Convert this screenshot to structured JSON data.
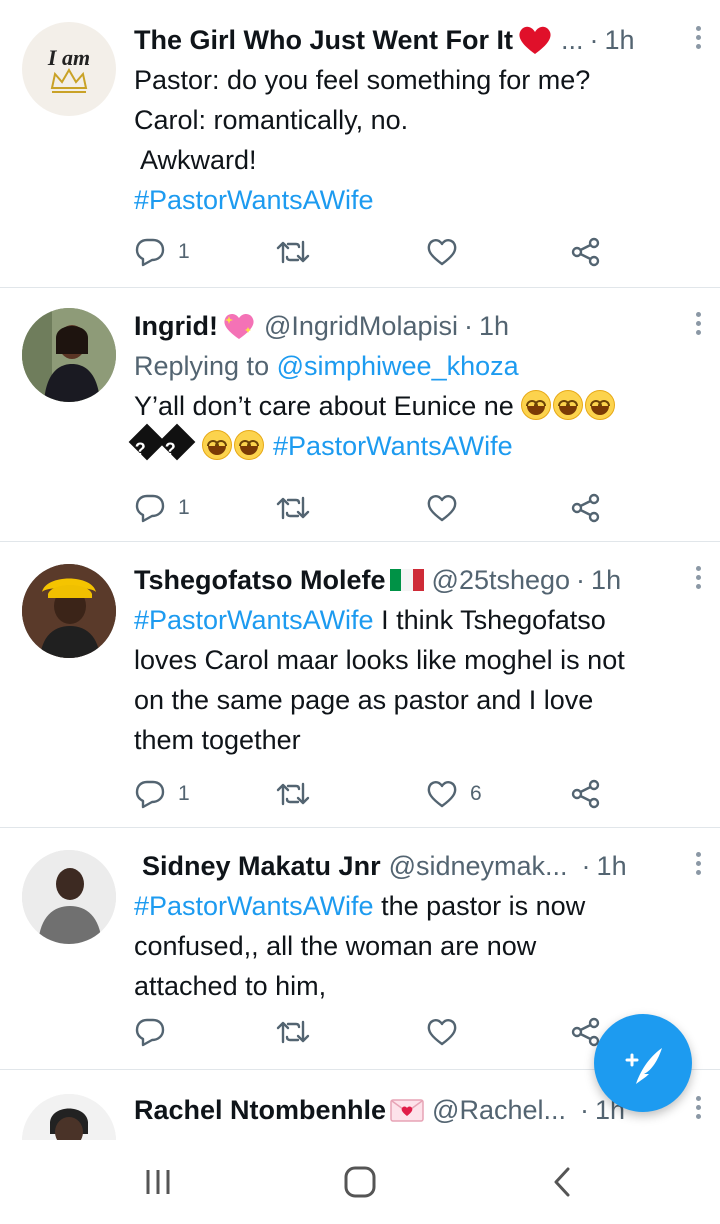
{
  "tweets": [
    {
      "name": "The Girl Who Just Went For It",
      "name_badge": "red-heart",
      "handle": "...",
      "time": "1h",
      "lines": [
        "Pastor: do you feel something for me?",
        "Carol: romantically, no.",
        " Awkward!"
      ],
      "hashtag": "#PastorWantsAWife",
      "reply_count": "1",
      "retweet_count": "",
      "like_count": ""
    },
    {
      "name": "Ingrid!",
      "name_badge": "sparkling-heart",
      "handle": "@IngridMolapisi",
      "time": "1h",
      "replying_label": "Replying to",
      "replying_to": "@simphiwee_khoza",
      "text": "Y’all don’t care about Eunice ne",
      "hashtag": "#PastorWantsAWife",
      "reply_count": "1",
      "retweet_count": "",
      "like_count": ""
    },
    {
      "name": "Tshegofatso Molefe",
      "name_badge": "italy-flag",
      "handle": "@25tshego",
      "time": "1h",
      "hashtag": "#PastorWantsAWife",
      "text_after_hashtag": " I think Tshegofatso",
      "lines": [
        "loves Carol maar looks like moghel is not",
        "on the same page as pastor and I love",
        "them together"
      ],
      "reply_count": "1",
      "retweet_count": "",
      "like_count": "6"
    },
    {
      "name": "Sidney Makatu Jnr",
      "handle": "@sidneymak...",
      "time": "1h",
      "hashtag": "#PastorWantsAWife",
      "text_after_hashtag": " the pastor is now",
      "lines": [
        "confused,, all the woman are now",
        "attached to him,"
      ],
      "reply_count": "",
      "retweet_count": "",
      "like_count": ""
    },
    {
      "name": "Rachel Ntombenhle",
      "name_badge": "love-letter",
      "handle": "@Rachel...",
      "time": "1h"
    }
  ],
  "icons": {
    "reply": "reply-icon",
    "retweet": "retweet-icon",
    "like": "like-icon",
    "share": "share-icon",
    "more": "more-icon",
    "compose": "compose-tweet-icon"
  },
  "colors": {
    "accent": "#1d9bf0",
    "secondary_text": "#536471",
    "divider": "#e1e6ea"
  },
  "system_nav": [
    "recent-apps",
    "home",
    "back"
  ]
}
